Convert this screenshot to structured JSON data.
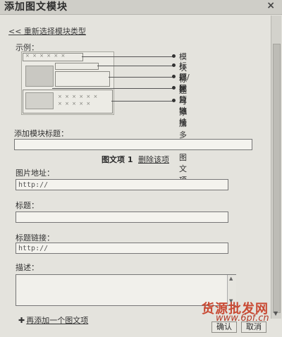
{
  "dialog": {
    "title": "添加图文模块",
    "close_glyph": "×"
  },
  "back_link": "<< 重新选择模块类型",
  "example": {
    "label": "示例：",
    "callouts": [
      "模块标题",
      "标题/标题链接",
      "描述",
      "图片地址",
      "可添加多个图文项"
    ]
  },
  "module_title": {
    "label": "添加模块标题：",
    "value": ""
  },
  "item": {
    "heading": "图文项 1",
    "delete_label": "删除该项"
  },
  "image_url": {
    "label": "图片地址：",
    "value": "http://"
  },
  "title_field": {
    "label": "标题：",
    "value": ""
  },
  "title_link": {
    "label": "标题链接：",
    "value": "http://"
  },
  "description": {
    "label": "描述：",
    "value": ""
  },
  "add_more": {
    "label": "再添加一个图文项",
    "icon": "plus-icon"
  },
  "buttons": {
    "confirm": "确认",
    "cancel": "取消"
  },
  "watermark": {
    "text": "货源批发网",
    "url": "www.6pf.cn"
  },
  "colors": {
    "background": "#e4e3dd",
    "titlebar": "#cfcec8",
    "watermark": "#c94a34"
  }
}
